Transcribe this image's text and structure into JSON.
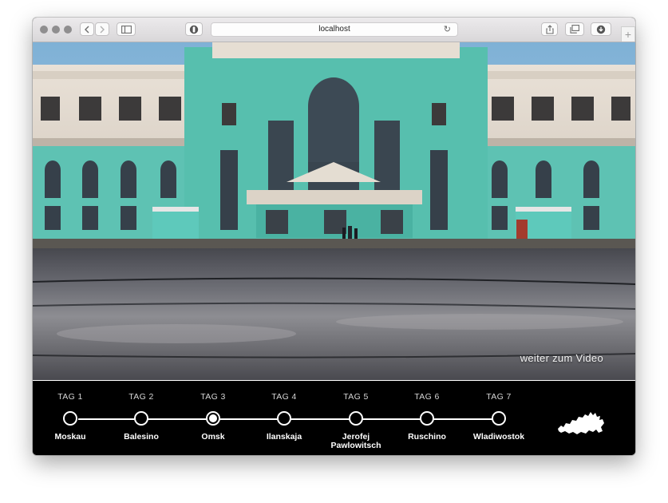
{
  "browser": {
    "address": "localhost",
    "nav_back_icon": "chevron-left-icon",
    "nav_forward_icon": "chevron-right-icon",
    "sidebar_icon": "sidebar-icon",
    "privacy_icon": "shield-icon",
    "reload_icon": "reload-icon",
    "share_icon": "share-icon",
    "tabs_icon": "tabs-icon",
    "downloads_icon": "download-icon",
    "new_tab_label": "+"
  },
  "panorama": {
    "video_link": "weiter zum Video"
  },
  "timeline": {
    "days": [
      {
        "tag": "TAG 1",
        "city": "Moskau",
        "active": false
      },
      {
        "tag": "TAG 2",
        "city": "Balesino",
        "active": false
      },
      {
        "tag": "TAG 3",
        "city": "Omsk",
        "active": true
      },
      {
        "tag": "TAG 4",
        "city": "Ilanskaja",
        "active": false
      },
      {
        "tag": "TAG 5",
        "city": "Jerofej Pawlowitsch",
        "active": false
      },
      {
        "tag": "TAG 6",
        "city": "Ruschino",
        "active": false
      },
      {
        "tag": "TAG 7",
        "city": "Wladiwostok",
        "active": false
      }
    ],
    "map_icon": "russia-map-icon"
  }
}
